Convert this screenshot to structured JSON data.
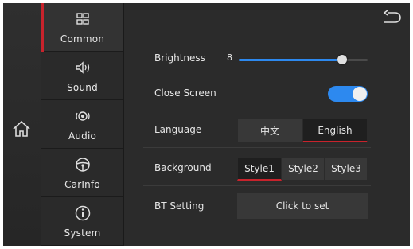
{
  "sidebar": {
    "items": [
      {
        "label": "Common",
        "icon": "grid-icon",
        "active": true
      },
      {
        "label": "Sound",
        "icon": "speaker-icon",
        "active": false
      },
      {
        "label": "Audio",
        "icon": "audio-icon",
        "active": false
      },
      {
        "label": "CarInfo",
        "icon": "steering-wheel-icon",
        "active": false
      },
      {
        "label": "System",
        "icon": "info-icon",
        "active": false
      }
    ]
  },
  "settings": {
    "brightness": {
      "label": "Brightness",
      "value": "8",
      "level": 0.8
    },
    "close_screen": {
      "label": "Close Screen",
      "on": true
    },
    "language": {
      "label": "Language",
      "options": [
        "中文",
        "English"
      ],
      "selected": "English"
    },
    "background": {
      "label": "Background",
      "options": [
        "Style1",
        "Style2",
        "Style3"
      ],
      "selected": "Style1"
    },
    "bt": {
      "label": "BT Setting",
      "button": "Click to set"
    }
  },
  "colors": {
    "accent": "#2d89ef",
    "selected_underline": "#c8232c",
    "panel": "#2b2b2b"
  }
}
